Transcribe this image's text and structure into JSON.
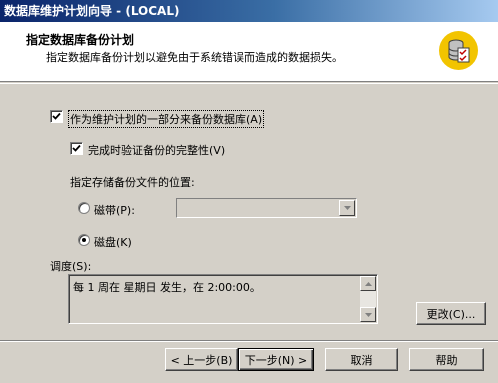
{
  "window": {
    "title": "数据库维护计划向导 - (LOCAL)"
  },
  "header": {
    "title": "指定数据库备份计划",
    "subtitle": "指定数据库备份计划以避免由于系统错误而造成的数据损失。",
    "icon": "database-checklist-icon"
  },
  "form": {
    "backup_checkbox": {
      "label": "作为维护计划的一部分来备份数据库(A)",
      "checked": true
    },
    "verify_checkbox": {
      "label": "完成时验证备份的完整性(V)",
      "checked": true
    },
    "location_label": "指定存储备份文件的位置:",
    "tape_radio": {
      "label": "磁带(P):",
      "selected": false
    },
    "tape_combo": {
      "value": "",
      "enabled": false
    },
    "disk_radio": {
      "label": "磁盘(K)",
      "selected": true
    },
    "schedule_label": "调度(S):",
    "schedule_text": "每 1 周在 星期日 发生，在 2:00:00。",
    "change_button": "更改(C)..."
  },
  "footer": {
    "back_button": "< 上一步(B)",
    "next_button": "下一步(N) >",
    "cancel_button": "取消",
    "help_button": "帮助"
  }
}
